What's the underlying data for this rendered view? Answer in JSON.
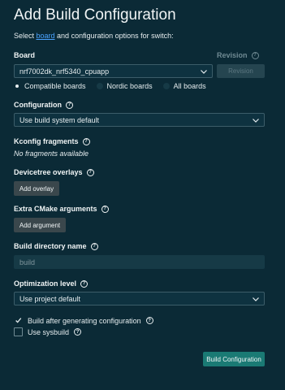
{
  "title": "Add Build Configuration",
  "subtitle": {
    "before": "Select ",
    "link": "board",
    "after": " and configuration options for switch:"
  },
  "board": {
    "label": "Board",
    "value": "nrf7002dk_nrf5340_cpuapp",
    "revision_label": "Revision",
    "revision_placeholder": "Revision",
    "filters": [
      {
        "label": "Compatible boards",
        "selected": true
      },
      {
        "label": "Nordic boards",
        "selected": false
      },
      {
        "label": "All boards",
        "selected": false
      }
    ]
  },
  "configuration": {
    "label": "Configuration",
    "value": "Use build system default"
  },
  "kconfig": {
    "label": "Kconfig fragments",
    "empty_text": "No fragments available"
  },
  "devicetree": {
    "label": "Devicetree overlays",
    "button": "Add overlay"
  },
  "cmake": {
    "label": "Extra CMake arguments",
    "button": "Add argument"
  },
  "build_dir": {
    "label": "Build directory name",
    "value": "build"
  },
  "optimization": {
    "label": "Optimization level",
    "value": "Use project default"
  },
  "options": {
    "build_after": {
      "label": "Build after generating configuration",
      "checked": true
    },
    "sysbuild": {
      "label": "Use sysbuild",
      "checked": false
    }
  },
  "submit": "Build Configuration",
  "colors": {
    "background": "#0b2a36",
    "primary_button": "#1a7a74",
    "link": "#4aa3ff"
  }
}
